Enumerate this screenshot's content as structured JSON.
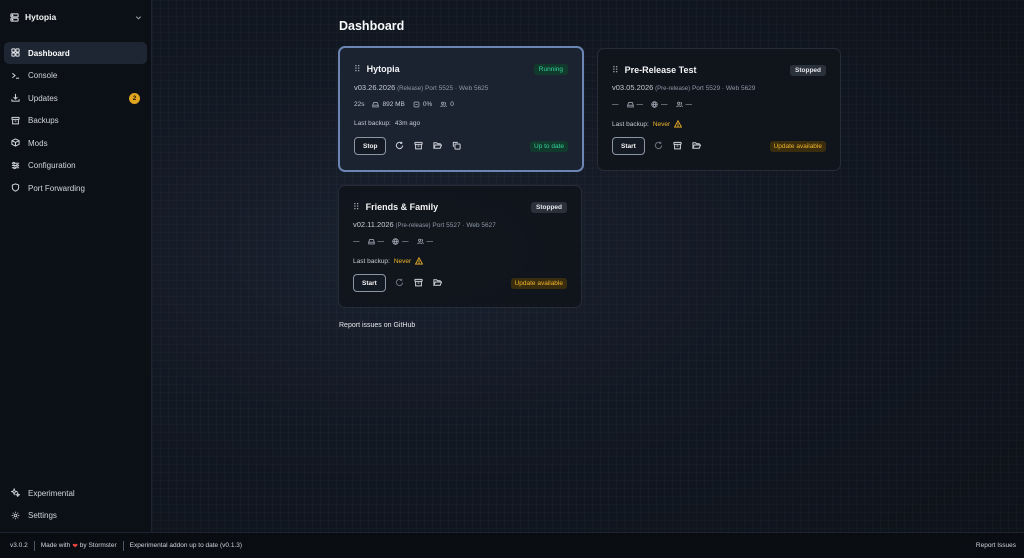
{
  "app": {
    "title": "Hytopia"
  },
  "sidebar": {
    "items": [
      {
        "label": "Dashboard",
        "icon": "dashboard-icon",
        "active": true
      },
      {
        "label": "Console",
        "icon": "terminal-icon"
      },
      {
        "label": "Updates",
        "icon": "download-icon",
        "badge": "2"
      },
      {
        "label": "Backups",
        "icon": "archive-icon"
      },
      {
        "label": "Mods",
        "icon": "package-icon"
      },
      {
        "label": "Configuration",
        "icon": "sliders-icon"
      },
      {
        "label": "Port Forwarding",
        "icon": "shield-icon"
      }
    ],
    "bottom": [
      {
        "label": "Experimental",
        "icon": "sparkles-icon"
      },
      {
        "label": "Settings",
        "icon": "gear-icon"
      }
    ]
  },
  "main": {
    "title": "Dashboard",
    "report_link": "Report issues on GitHub"
  },
  "servers": [
    {
      "name": "Hytopia",
      "status": "Running",
      "version": "v03.26.2026",
      "channel": "(Release)",
      "ports": "Port 5525 · Web 5625",
      "uptime": "22s",
      "memory": "892 MB",
      "cpu": "0%",
      "players": "0",
      "backup_label": "Last backup:",
      "backup_value": "43m ago",
      "primary_action": "Stop",
      "update_state": "Up to date"
    },
    {
      "name": "Pre-Release Test",
      "status": "Stopped",
      "version": "v03.05.2026",
      "channel": "(Pre-release)",
      "ports": "Port 5529 · Web 5629",
      "uptime": "—",
      "memory": "—",
      "cpu": "—",
      "players": "—",
      "backup_label": "Last backup:",
      "backup_value": "Never",
      "primary_action": "Start",
      "update_state": "Update available"
    },
    {
      "name": "Friends & Family",
      "status": "Stopped",
      "version": "v02.11.2026",
      "channel": "(Pre-release)",
      "ports": "Port 5527 · Web 5627",
      "uptime": "—",
      "memory": "—",
      "cpu": "—",
      "players": "—",
      "backup_label": "Last backup:",
      "backup_value": "Never",
      "primary_action": "Start",
      "update_state": "Update available"
    }
  ],
  "footer": {
    "version": "v3.0.2",
    "made_with": "Made with",
    "by": "by Stormster",
    "addon_status": "Experimental addon up to date (v0.1.3)",
    "report": "Report Issues"
  }
}
